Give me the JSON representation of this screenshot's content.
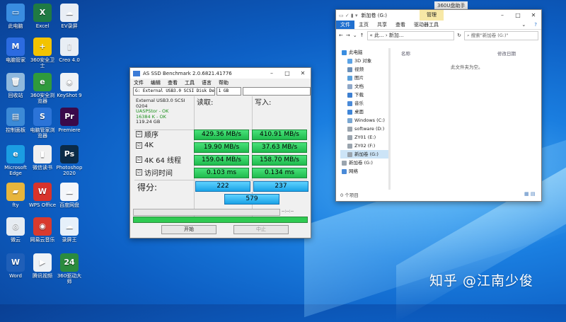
{
  "desktop": {
    "icons": [
      {
        "label": "此电脑",
        "color": "#3a8de0",
        "glyph": "▭"
      },
      {
        "label": "Excel",
        "color": "#1f7a44",
        "glyph": "X"
      },
      {
        "label": "EV录屏",
        "color": "#e9eef5",
        "glyph": "☁"
      },
      {
        "label": "电脑管家",
        "color": "#2c6be0",
        "glyph": "M"
      },
      {
        "label": "360安全卫士",
        "color": "#f3c300",
        "glyph": "+"
      },
      {
        "label": "Creo 4.0",
        "color": "#e8eef4",
        "glyph": "▯"
      },
      {
        "label": "回收站",
        "color": "#8fb8dd",
        "glyph": "🗑"
      },
      {
        "label": "360安全浏览器",
        "color": "#2f9a3c",
        "glyph": "e"
      },
      {
        "label": "KeyShot 9",
        "color": "#eef2f6",
        "glyph": "◉"
      },
      {
        "label": "控制面板",
        "color": "#3c8ad6",
        "glyph": "▤"
      },
      {
        "label": "电脑管家浏览器",
        "color": "#2c74d8",
        "glyph": "S"
      },
      {
        "label": "Premiere",
        "color": "#3a0a4a",
        "glyph": "Pr"
      },
      {
        "label": "Microsoft Edge",
        "color": "#1b9de2",
        "glyph": "e"
      },
      {
        "label": "微信读书",
        "color": "#f0f0f0",
        "glyph": "▮"
      },
      {
        "label": "Photoshop 2020",
        "color": "#0b2b48",
        "glyph": "Ps"
      },
      {
        "label": "fty",
        "color": "#e7b53c",
        "glyph": "▰"
      },
      {
        "label": "WPS Office",
        "color": "#d8332b",
        "glyph": "W"
      },
      {
        "label": "百度网盘",
        "color": "#f4f6fa",
        "glyph": "☁"
      },
      {
        "label": "微云",
        "color": "#e6ecf2",
        "glyph": "◎"
      },
      {
        "label": "网易云音乐",
        "color": "#d83a2e",
        "glyph": "◉"
      },
      {
        "label": "录屏王",
        "color": "#e6f0fa",
        "glyph": "☁"
      },
      {
        "label": "Word",
        "color": "#1f5fb8",
        "glyph": "W"
      },
      {
        "label": "腾讯视频",
        "color": "#eef2f6",
        "glyph": "▶"
      },
      {
        "label": "360驱动大师",
        "color": "#2b8b3e",
        "glyph": "24"
      }
    ]
  },
  "ssd": {
    "title": "AS SSD Benchmark 2.0.6821.41776",
    "menu": [
      "文件",
      "编辑",
      "查看",
      "工具",
      "语言",
      "帮助"
    ],
    "drive_select": "G: External USB3.0 SCSI Disk Devi",
    "size_select": "1 GB",
    "info": [
      "External USB3.0 SCSI",
      "0204",
      "UASPStor - OK",
      "16384 K - OK",
      "119.24 GB"
    ],
    "read_header": "读取:",
    "write_header": "写入:",
    "rows": [
      {
        "label": "顺序",
        "read": "429.36 MB/s",
        "write": "410.91 MB/s"
      },
      {
        "label": "4K",
        "read": "19.90 MB/s",
        "write": "37.63 MB/s"
      },
      {
        "label": "4K 64 线程",
        "read": "159.04 MB/s",
        "write": "158.70 MB/s"
      },
      {
        "label": "访问时间",
        "read": "0.103 ms",
        "write": "0.134 ms"
      }
    ],
    "score_label": "得分:",
    "score_read": "222",
    "score_write": "237",
    "score_total": "579",
    "timer": "--:--:--",
    "start": "开始",
    "abort": "中止"
  },
  "explorer": {
    "title": "新加卷 (G:)",
    "manage_tab": "管理",
    "ribbon": [
      "文件",
      "主页",
      "共享",
      "查看",
      "驱动器工具"
    ],
    "breadcrumb": "« 此... › 新加...",
    "search_placeholder": "搜索\"新加卷 (G:)\"",
    "nav": [
      {
        "label": "此电脑",
        "color": "#3a8de0"
      },
      {
        "label": "3D 对象",
        "color": "#5ba3e6"
      },
      {
        "label": "视频",
        "color": "#6a8fb8"
      },
      {
        "label": "图片",
        "color": "#5aa0dc"
      },
      {
        "label": "文档",
        "color": "#8fa8c8"
      },
      {
        "label": "下载",
        "color": "#3d7fd0"
      },
      {
        "label": "音乐",
        "color": "#4a8ad8"
      },
      {
        "label": "桌面",
        "color": "#3f86d8"
      },
      {
        "label": "Windows (C:)",
        "color": "#7aa7d2"
      },
      {
        "label": "software (D:)",
        "color": "#9aa4ae"
      },
      {
        "label": "ZY01 (E:)",
        "color": "#9aa4ae"
      },
      {
        "label": "ZY02 (F:)",
        "color": "#9aa4ae"
      },
      {
        "label": "新加卷 (G:)",
        "color": "#9aa4ae"
      },
      {
        "label": "新加卷 (G:)",
        "color": "#9aa4ae"
      },
      {
        "label": "网络",
        "color": "#4a8ad8"
      }
    ],
    "col_name": "名称",
    "col_date": "修改日期",
    "empty_msg": "此文件夹为空。",
    "status": "0 个项目"
  },
  "notification": "360U盘助手",
  "watermark": "知乎 @江南少俊"
}
